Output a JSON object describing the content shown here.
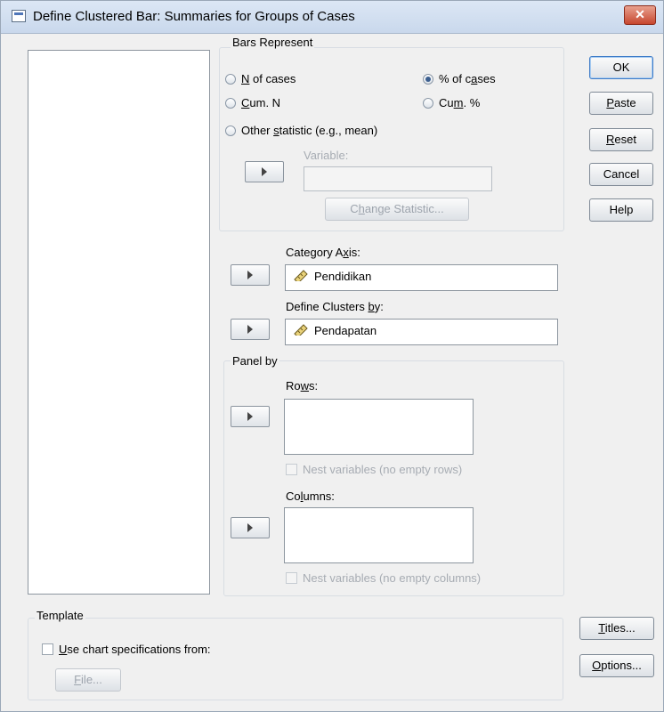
{
  "window": {
    "title": "Define Clustered Bar: Summaries for Groups of Cases",
    "close_label": "✕"
  },
  "bars_represent": {
    "legend": "Bars Represent",
    "options": [
      {
        "pre": "",
        "key": "N",
        "post": " of cases",
        "selected": false
      },
      {
        "pre": "% of c",
        "key": "a",
        "post": "ses",
        "selected": true
      },
      {
        "pre": "",
        "key": "C",
        "post": "um. N",
        "selected": false
      },
      {
        "pre": "Cu",
        "key": "m",
        "post": ". %",
        "selected": false
      },
      {
        "pre": "Other ",
        "key": "s",
        "post": "tatistic (e.g., mean)",
        "selected": false
      }
    ],
    "variable_label": "Variable:",
    "change_statistic": {
      "pre": "C",
      "key": "h",
      "post": "ange Statistic..."
    }
  },
  "category_axis": {
    "label_pre": "Category A",
    "label_key": "x",
    "label_post": "is:",
    "value": "Pendidikan"
  },
  "define_clusters": {
    "label_pre": "Define Clusters ",
    "label_key": "b",
    "label_post": "y:",
    "value": "Pendapatan"
  },
  "panel_by": {
    "legend": "Panel by",
    "rows_label_pre": "Ro",
    "rows_label_key": "w",
    "rows_label_post": "s:",
    "nest_rows": "Nest variables (no empty rows)",
    "columns_label_pre": "Co",
    "columns_label_key": "l",
    "columns_label_post": "umns:",
    "nest_columns": "Nest variables (no empty columns)"
  },
  "buttons": {
    "ok": "OK",
    "paste": {
      "key": "P",
      "post": "aste"
    },
    "reset": {
      "key": "R",
      "post": "eset"
    },
    "cancel": "Cancel",
    "help": "Help",
    "titles": {
      "key": "T",
      "post": "itles..."
    },
    "options": {
      "key": "O",
      "post": "ptions..."
    }
  },
  "template": {
    "legend": "Template",
    "use_spec": {
      "key": "U",
      "post": "se chart specifications from:"
    },
    "file": {
      "key": "F",
      "post": "ile..."
    }
  },
  "icons": {
    "scale_variable": "ruler-icon",
    "move_arrow": "right-arrow-icon"
  },
  "colors": {
    "titlebar": "#c9d8ec",
    "close": "#c7472f",
    "ruler_yellow": "#e9d27a"
  }
}
